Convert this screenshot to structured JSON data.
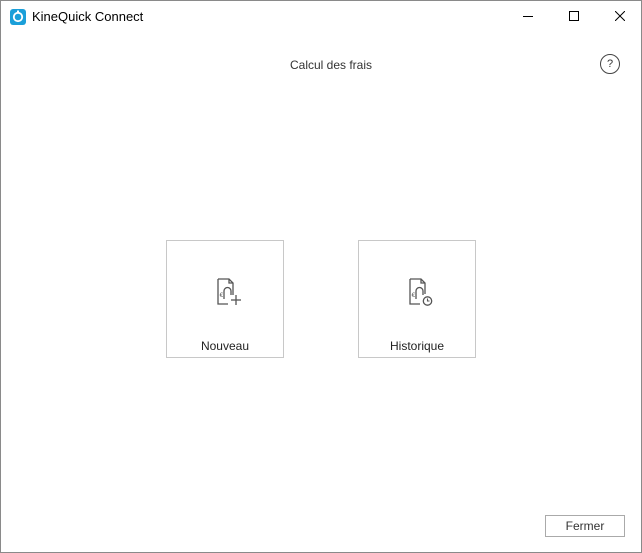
{
  "window": {
    "title": "KineQuick Connect",
    "app_icon": "kinequick-logo-icon",
    "controls": [
      "minimize-icon",
      "maximize-icon",
      "close-icon"
    ]
  },
  "header": {
    "title": "Calcul des frais",
    "help_label": "?"
  },
  "tiles": [
    {
      "label": "Nouveau",
      "icon": "document-euro-add-icon"
    },
    {
      "label": "Historique",
      "icon": "document-euro-history-icon"
    }
  ],
  "footer": {
    "close_label": "Fermer"
  },
  "colors": {
    "accent": "#1a9fd9",
    "border": "#c8c8c8"
  }
}
